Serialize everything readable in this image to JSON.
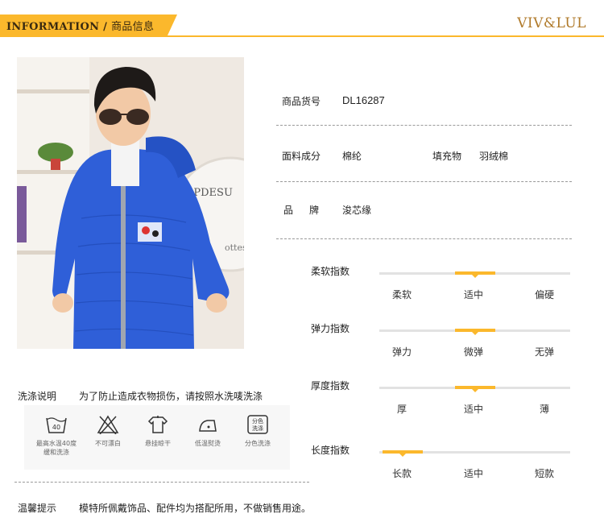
{
  "header": {
    "tag_en": "INFORMATION",
    "tag_sep": " / ",
    "tag_cn": "商品信息",
    "brand": "VIV&LUL"
  },
  "product": {
    "item_no_label": "商品货号",
    "item_no": "DL16287",
    "fabric_label": "面料成分",
    "fabric": "棉纶",
    "filling_label": "填充物",
    "filling": "羽绒棉",
    "brand_label_1": "品",
    "brand_label_2": "牌",
    "brand_value": "浚芯缘"
  },
  "photo": {
    "text_pieces": [
      "APDESU",
      "ottes"
    ]
  },
  "indices": [
    {
      "title": "柔软指数",
      "options": [
        "柔软",
        "适中",
        "偏硬"
      ],
      "level": 0.5
    },
    {
      "title": "弹力指数",
      "options": [
        "弹力",
        "微弹",
        "无弹"
      ],
      "level": 0.5
    },
    {
      "title": "厚度指数",
      "options": [
        "厚",
        "适中",
        "薄"
      ],
      "level": 0.5
    },
    {
      "title": "长度指数",
      "options": [
        "长款",
        "适中",
        "短款"
      ],
      "level": 0.0
    }
  ],
  "care": {
    "label": "洗涤说明",
    "text": "为了防止造成衣物损伤，请按照水洗唛洗涤",
    "items": [
      {
        "icon": "wash-40-icon",
        "caption_1": "最高水温40度",
        "caption_2": "缓和洗涤",
        "glyph": "40"
      },
      {
        "icon": "no-bleach-icon",
        "caption_1": "不可漂白",
        "caption_2": ""
      },
      {
        "icon": "hang-dry-icon",
        "caption_1": "悬挂晾干",
        "caption_2": ""
      },
      {
        "icon": "low-iron-icon",
        "caption_1": "低温熨烫",
        "caption_2": ""
      },
      {
        "icon": "separate-wash-icon",
        "caption_1": "分色洗涤",
        "caption_2": "",
        "glyph_1": "分色",
        "glyph_2": "洗涤"
      }
    ]
  },
  "tip": {
    "label": "温馨提示",
    "text": "模特所佩戴饰品、配件均为搭配所用，不做销售用途。"
  },
  "colors": {
    "accent": "#fbb82c",
    "brand": "#b07a2a",
    "jacket": "#2f5fd8"
  }
}
